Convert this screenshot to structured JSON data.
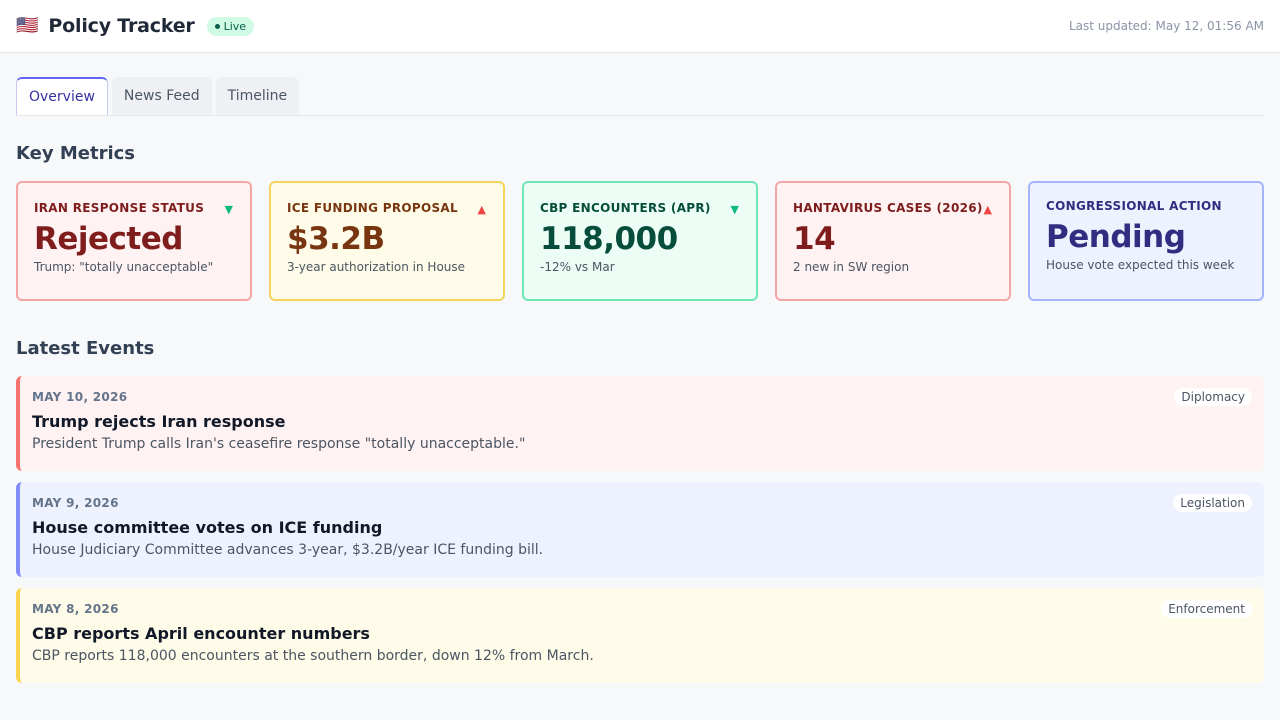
{
  "header": {
    "flag": "🇺🇸",
    "title": "Policy Tracker",
    "live_label": "Live",
    "last_updated": "Last updated: May 12, 01:56 AM"
  },
  "tabs": [
    {
      "label": "Overview",
      "active": true
    },
    {
      "label": "News Feed",
      "active": false
    },
    {
      "label": "Timeline",
      "active": false
    }
  ],
  "metrics_section": {
    "title": "Key Metrics",
    "cards": [
      {
        "label": "IRAN RESPONSE STATUS",
        "value": "Rejected",
        "sub": "Trump: \"totally unacceptable\"",
        "trend": "▼",
        "trend_dir": "down",
        "color": "#dc2626"
      },
      {
        "label": "ICE FUNDING PROPOSAL",
        "value": "$3.2B",
        "sub": "3-year authorization in House",
        "trend": "▲",
        "trend_dir": "up",
        "color": "#d97706"
      },
      {
        "label": "CBP ENCOUNTERS (APR)",
        "value": "118,000",
        "sub": "-12% vs Mar",
        "trend": "▼",
        "trend_dir": "down",
        "color": "#059669"
      },
      {
        "label": "HANTAVIRUS CASES (2026)",
        "value": "14",
        "sub": "2 new in SW region",
        "trend": "▲",
        "trend_dir": "up",
        "color": "#dc2626"
      },
      {
        "label": "CONGRESSIONAL ACTION",
        "value": "Pending",
        "sub": "House vote expected this week",
        "trend": "",
        "trend_dir": "",
        "color": "#4f46e5"
      }
    ]
  },
  "events_section": {
    "title": "Latest Events",
    "events": [
      {
        "date": "MAY 10, 2026",
        "title": "Trump rejects Iran response",
        "desc": "President Trump calls Iran's ceasefire response \"totally unacceptable.\"",
        "tag": "Diplomacy"
      },
      {
        "date": "MAY 9, 2026",
        "title": "House committee votes on ICE funding",
        "desc": "House Judiciary Committee advances 3-year, $3.2B/year ICE funding bill.",
        "tag": "Legislation"
      },
      {
        "date": "MAY 8, 2026",
        "title": "CBP reports April encounter numbers",
        "desc": "CBP reports 118,000 encounters at the southern border, down 12% from March.",
        "tag": "Enforcement"
      }
    ]
  }
}
